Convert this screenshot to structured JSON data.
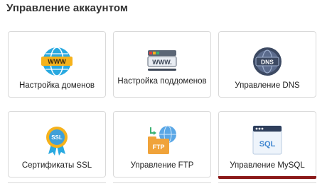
{
  "section": {
    "title": "Управление аккаунтом"
  },
  "tiles": [
    {
      "label": "Настройка доменов",
      "icon": "globe-www-icon",
      "icon_text": "WWW"
    },
    {
      "label": "Настройка поддоменов",
      "icon": "subdomain-bar-icon",
      "icon_text": "WWW."
    },
    {
      "label": "Управление DNS",
      "icon": "dns-globe-icon",
      "icon_text": "DNS"
    },
    {
      "label": "Сертификаты SSL",
      "icon": "ssl-badge-icon",
      "icon_text": "SSL"
    },
    {
      "label": "Управление FTP",
      "icon": "ftp-folder-globe-icon",
      "icon_text": "FTP"
    },
    {
      "label": "Управление MySQL",
      "icon": "sql-window-icon",
      "icon_text": "SQL",
      "active": true
    }
  ],
  "colors": {
    "active_accent": "#8b1a1a",
    "border": "#d9d9d9"
  }
}
